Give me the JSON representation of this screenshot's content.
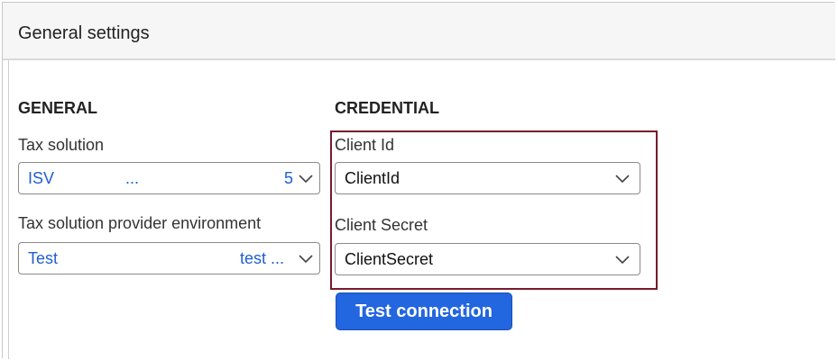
{
  "panel": {
    "title": "General settings"
  },
  "general": {
    "heading": "GENERAL",
    "tax_solution": {
      "label": "Tax solution",
      "value": "ISV",
      "value_mid": "...",
      "value_right": "5"
    },
    "provider_environment": {
      "label": "Tax solution provider environment",
      "value": "Test",
      "value_right": "test ..."
    }
  },
  "credential": {
    "heading": "CREDENTIAL",
    "client_id": {
      "label": "Client Id",
      "value": "ClientId"
    },
    "client_secret": {
      "label": "Client Secret",
      "value": "ClientSecret"
    },
    "test_button_label": "Test connection"
  },
  "icons": {
    "dropdown": "chevron-down-icon"
  },
  "colors": {
    "accent_button": "#2266e0",
    "link_value": "#1f5fd0",
    "highlight_border": "#7a1a2c"
  }
}
